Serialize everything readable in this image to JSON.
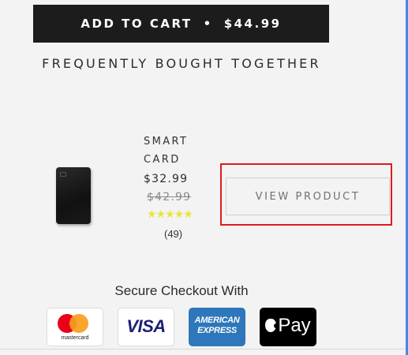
{
  "cart_button": {
    "label": "ADD TO CART",
    "separator": "•",
    "price": "$44.99"
  },
  "section_title": "FREQUENTLY BOUGHT TOGETHER",
  "product": {
    "image_icon": "smart-card-image",
    "name": "SMART CARD",
    "price": "$32.99",
    "old_price": "$42.99",
    "rating": 5,
    "rating_max": 5,
    "stars": "★★★★★",
    "reviews": "(49)",
    "view_button": "VIEW PRODUCT"
  },
  "checkout": {
    "label": "Secure Checkout With",
    "methods": {
      "mastercard": "mastercard",
      "visa": "VISA",
      "amex": "AMERICAN EXPRESS",
      "applepay": "Pay"
    }
  },
  "colors": {
    "cart_button_bg": "#1c1c1c",
    "highlight": "#e0191a",
    "stars": "#e8e63a"
  }
}
